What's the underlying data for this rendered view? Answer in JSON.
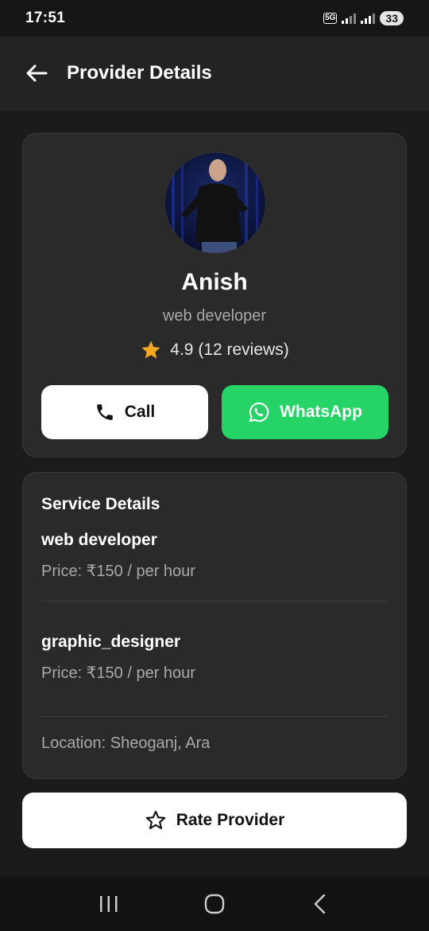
{
  "status_bar": {
    "time": "17:51",
    "network": "5G",
    "battery": "33",
    "icons": [
      "wifi-signal-icon",
      "cell-signal-icon",
      "battery-icon"
    ]
  },
  "app_bar": {
    "title": "Provider Details",
    "back_icon": "arrow-left-icon"
  },
  "profile": {
    "name": "Anish",
    "role": "web developer",
    "rating_value": "4.9",
    "rating_text": "4.9 (12 reviews)",
    "star_color": "#f5a623",
    "call_label": "Call",
    "whatsapp_label": "WhatsApp",
    "whatsapp_color": "#25d366"
  },
  "service_details": {
    "title": "Service Details",
    "services": [
      {
        "name": "web developer",
        "price": "Price: ₹150 / per hour"
      },
      {
        "name": "graphic_designer",
        "price": "Price: ₹150 / per hour"
      }
    ],
    "location": "Location: Sheoganj, Ara"
  },
  "rate_button": {
    "label": "Rate Provider",
    "icon": "star-outline-icon"
  },
  "nav_bar": {
    "items": [
      "recent-apps-icon",
      "home-icon",
      "back-icon"
    ]
  }
}
